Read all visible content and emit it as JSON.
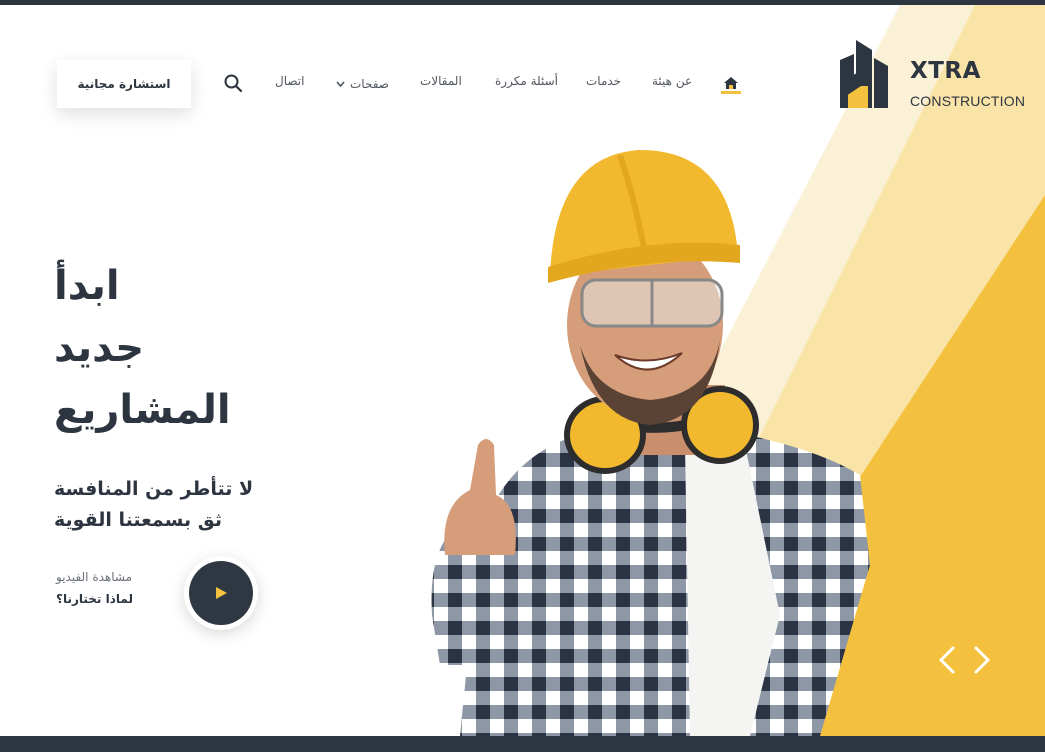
{
  "brand": {
    "title": "XTRA",
    "subtitle": "CONSTRUCTION"
  },
  "nav": {
    "items": [
      {
        "label": "عن هيئة"
      },
      {
        "label": "خدمات"
      },
      {
        "label": "أسئلة مكررة"
      },
      {
        "label": "المقالات"
      },
      {
        "label": "صفحات"
      },
      {
        "label": "اتصال"
      }
    ]
  },
  "header": {
    "cta_label": "استشارة مجانية"
  },
  "hero": {
    "title_lines": [
      "ابدأ",
      "جديد",
      "المشاريع"
    ],
    "subtitle_lines": [
      "لا تتأطر من المنافسة",
      "ثق بسمعتنا القوية"
    ]
  },
  "video": {
    "small_label": "مشاهدة الفيديو",
    "main_label": "لماذا تختارنا؟"
  },
  "icons": [
    "home-icon",
    "chevron-down-icon",
    "search-icon",
    "play-icon",
    "chevron-left-icon",
    "chevron-right-icon"
  ],
  "colors": {
    "accent": "#f4c13e",
    "accent_light": "#fbe7b0",
    "dark": "#2d3540"
  }
}
